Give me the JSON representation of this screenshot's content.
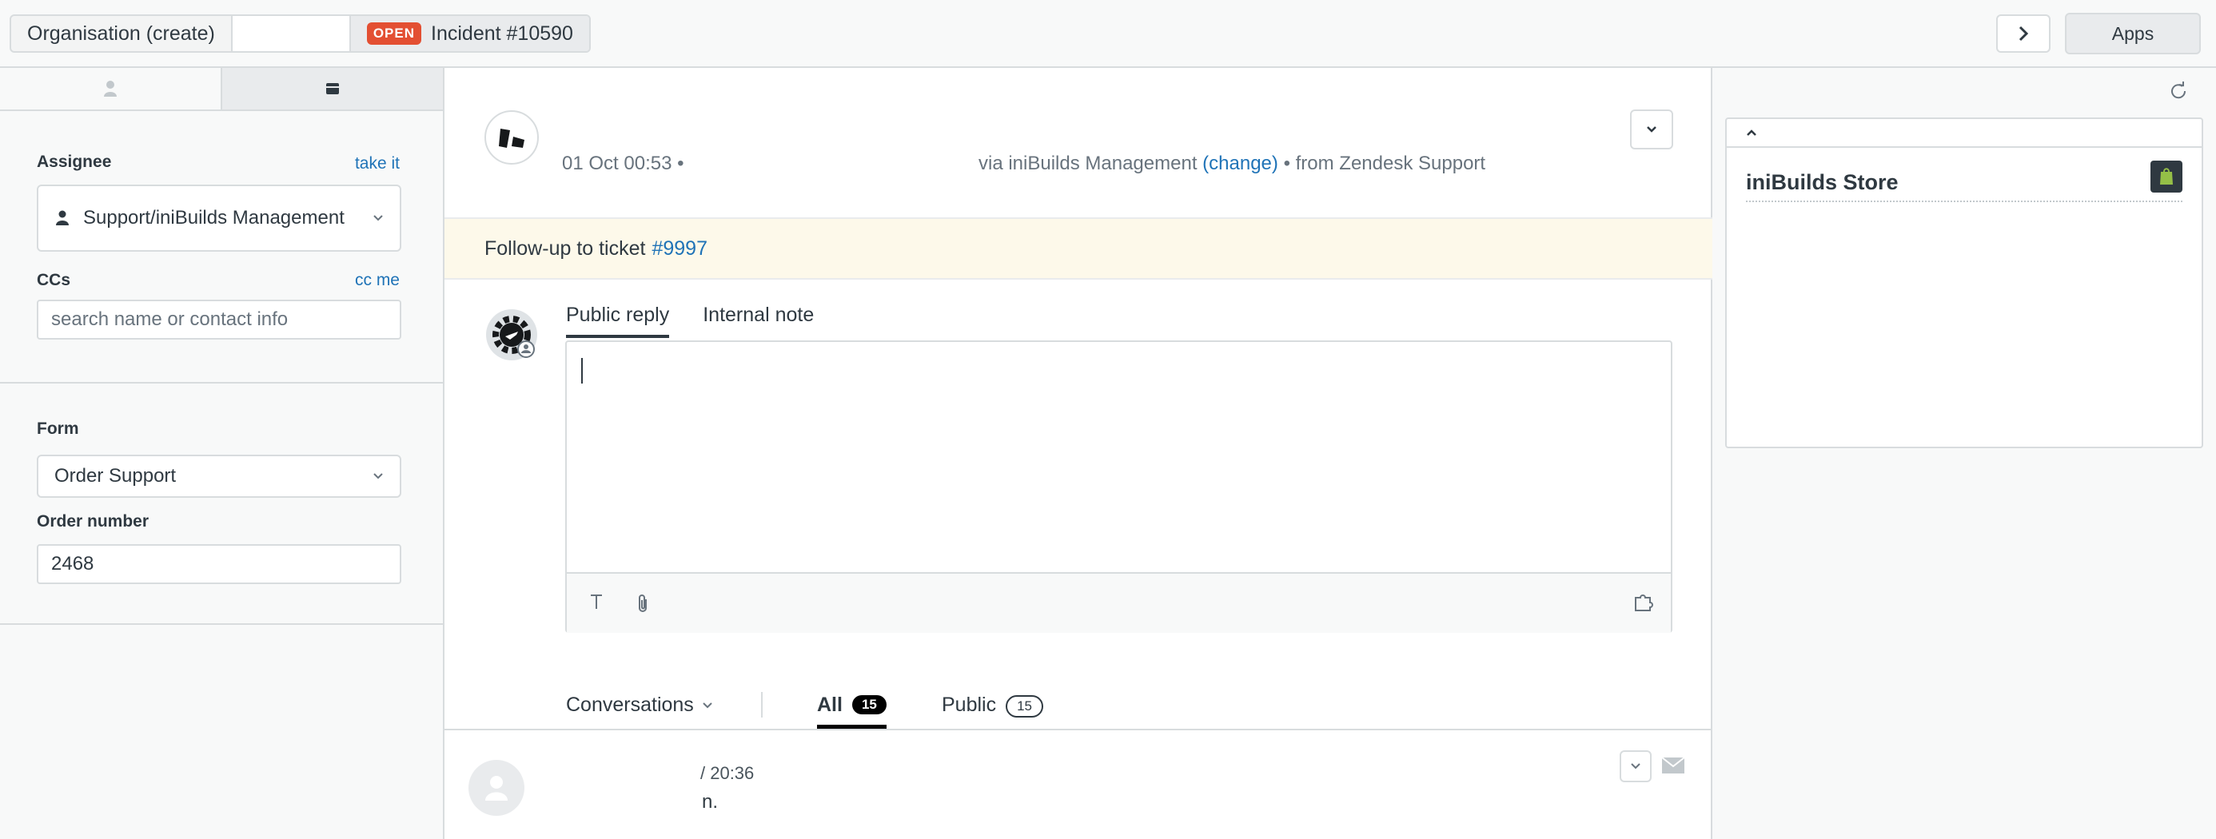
{
  "topbar": {
    "org_tab": "Organisation (create)",
    "status_badge": "OPEN",
    "ticket_tab": "Incident #10590",
    "apps_label": "Apps"
  },
  "sidebar": {
    "assignee_label": "Assignee",
    "take_it": "take it",
    "assignee_value": "Support/iniBuilds Management",
    "ccs_label": "CCs",
    "cc_me": "cc me",
    "ccs_placeholder": "search name or contact info",
    "form_label": "Form",
    "form_value": "Order Support",
    "order_number_label": "Order number",
    "order_number_value": "2468"
  },
  "header": {
    "timestamp": "01 Oct 00:53",
    "via": "via iniBuilds Management",
    "change": "(change)",
    "from": "• from Zendesk Support"
  },
  "followup": {
    "text": "Follow-up to ticket",
    "link": "#9997"
  },
  "composer": {
    "tabs": [
      "Public reply",
      "Internal note"
    ],
    "active_tab": "Public reply"
  },
  "conversations": {
    "dropdown_label": "Conversations",
    "tab_all": "All",
    "tab_all_count": "15",
    "tab_public": "Public",
    "tab_public_count": "15"
  },
  "comment": {
    "time": "/ 20:36",
    "text": "n."
  },
  "apps_panel": {
    "title": "iniBuilds Store"
  },
  "colors": {
    "accent_link": "#1f73b7",
    "open_badge": "#e34f32",
    "followup_bg": "#fdf9ea"
  }
}
